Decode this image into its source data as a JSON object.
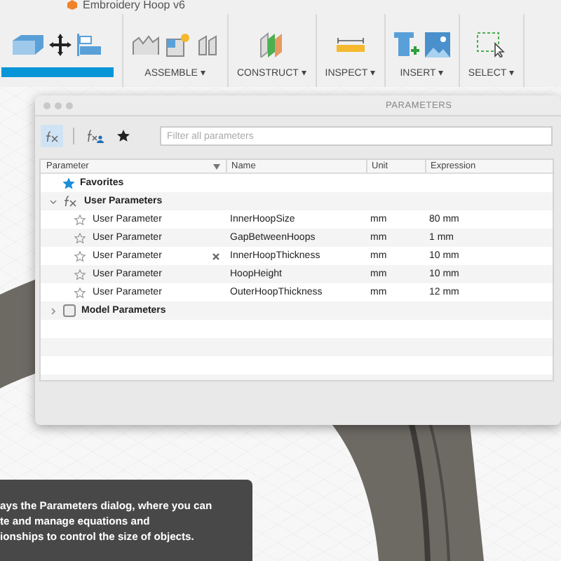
{
  "document_title": "Embroidery Hoop v6",
  "toolbar": {
    "groups": [
      {
        "kind": "modify",
        "selected": true
      },
      {
        "kind": "assemble",
        "label": "ASSEMBLE ▾",
        "selected": false
      },
      {
        "kind": "construct",
        "label": "CONSTRUCT ▾",
        "selected": false
      },
      {
        "kind": "inspect",
        "label": "INSPECT ▾",
        "selected": false
      },
      {
        "kind": "insert",
        "label": "INSERT ▾",
        "selected": false
      },
      {
        "kind": "select",
        "label": "SELECT ▾",
        "selected": false
      }
    ]
  },
  "dialog": {
    "title": "PARAMETERS",
    "tools": [
      {
        "kind": "all",
        "selected": true
      },
      {
        "kind": "user",
        "selected": false
      },
      {
        "kind": "favorites",
        "selected": false
      }
    ],
    "filter": {
      "placeholder": "Filter all parameters"
    },
    "columns": [
      "Parameter",
      "Name",
      "Unit",
      "Expression"
    ],
    "tree": [
      {
        "kind": "favorites",
        "label": "Favorites"
      },
      {
        "kind": "user",
        "label": "User Parameters",
        "expanded": true,
        "children": [
          {
            "type": "User Parameter",
            "name": "InnerHoopSize",
            "unit": "mm",
            "expression": "80 mm",
            "favorite": false,
            "marked": false
          },
          {
            "type": "User Parameter",
            "name": "GapBetweenHoops",
            "unit": "mm",
            "expression": "1 mm",
            "favorite": false,
            "marked": false
          },
          {
            "type": "User Parameter",
            "name": "InnerHoopThickness",
            "unit": "mm",
            "expression": "10 mm",
            "favorite": false,
            "marked": true
          },
          {
            "type": "User Parameter",
            "name": "HoopHeight",
            "unit": "mm",
            "expression": "10 mm",
            "favorite": false,
            "marked": false
          },
          {
            "type": "User Parameter",
            "name": "OuterHoopThickness",
            "unit": "mm",
            "expression": "12 mm",
            "favorite": false,
            "marked": false
          }
        ]
      },
      {
        "kind": "model",
        "label": "Model Parameters",
        "expanded": false
      }
    ]
  },
  "tooltip": {
    "lines": [
      "ays the Parameters dialog, where you can",
      "te and manage equations and",
      "ionships to control the size of objects."
    ]
  }
}
